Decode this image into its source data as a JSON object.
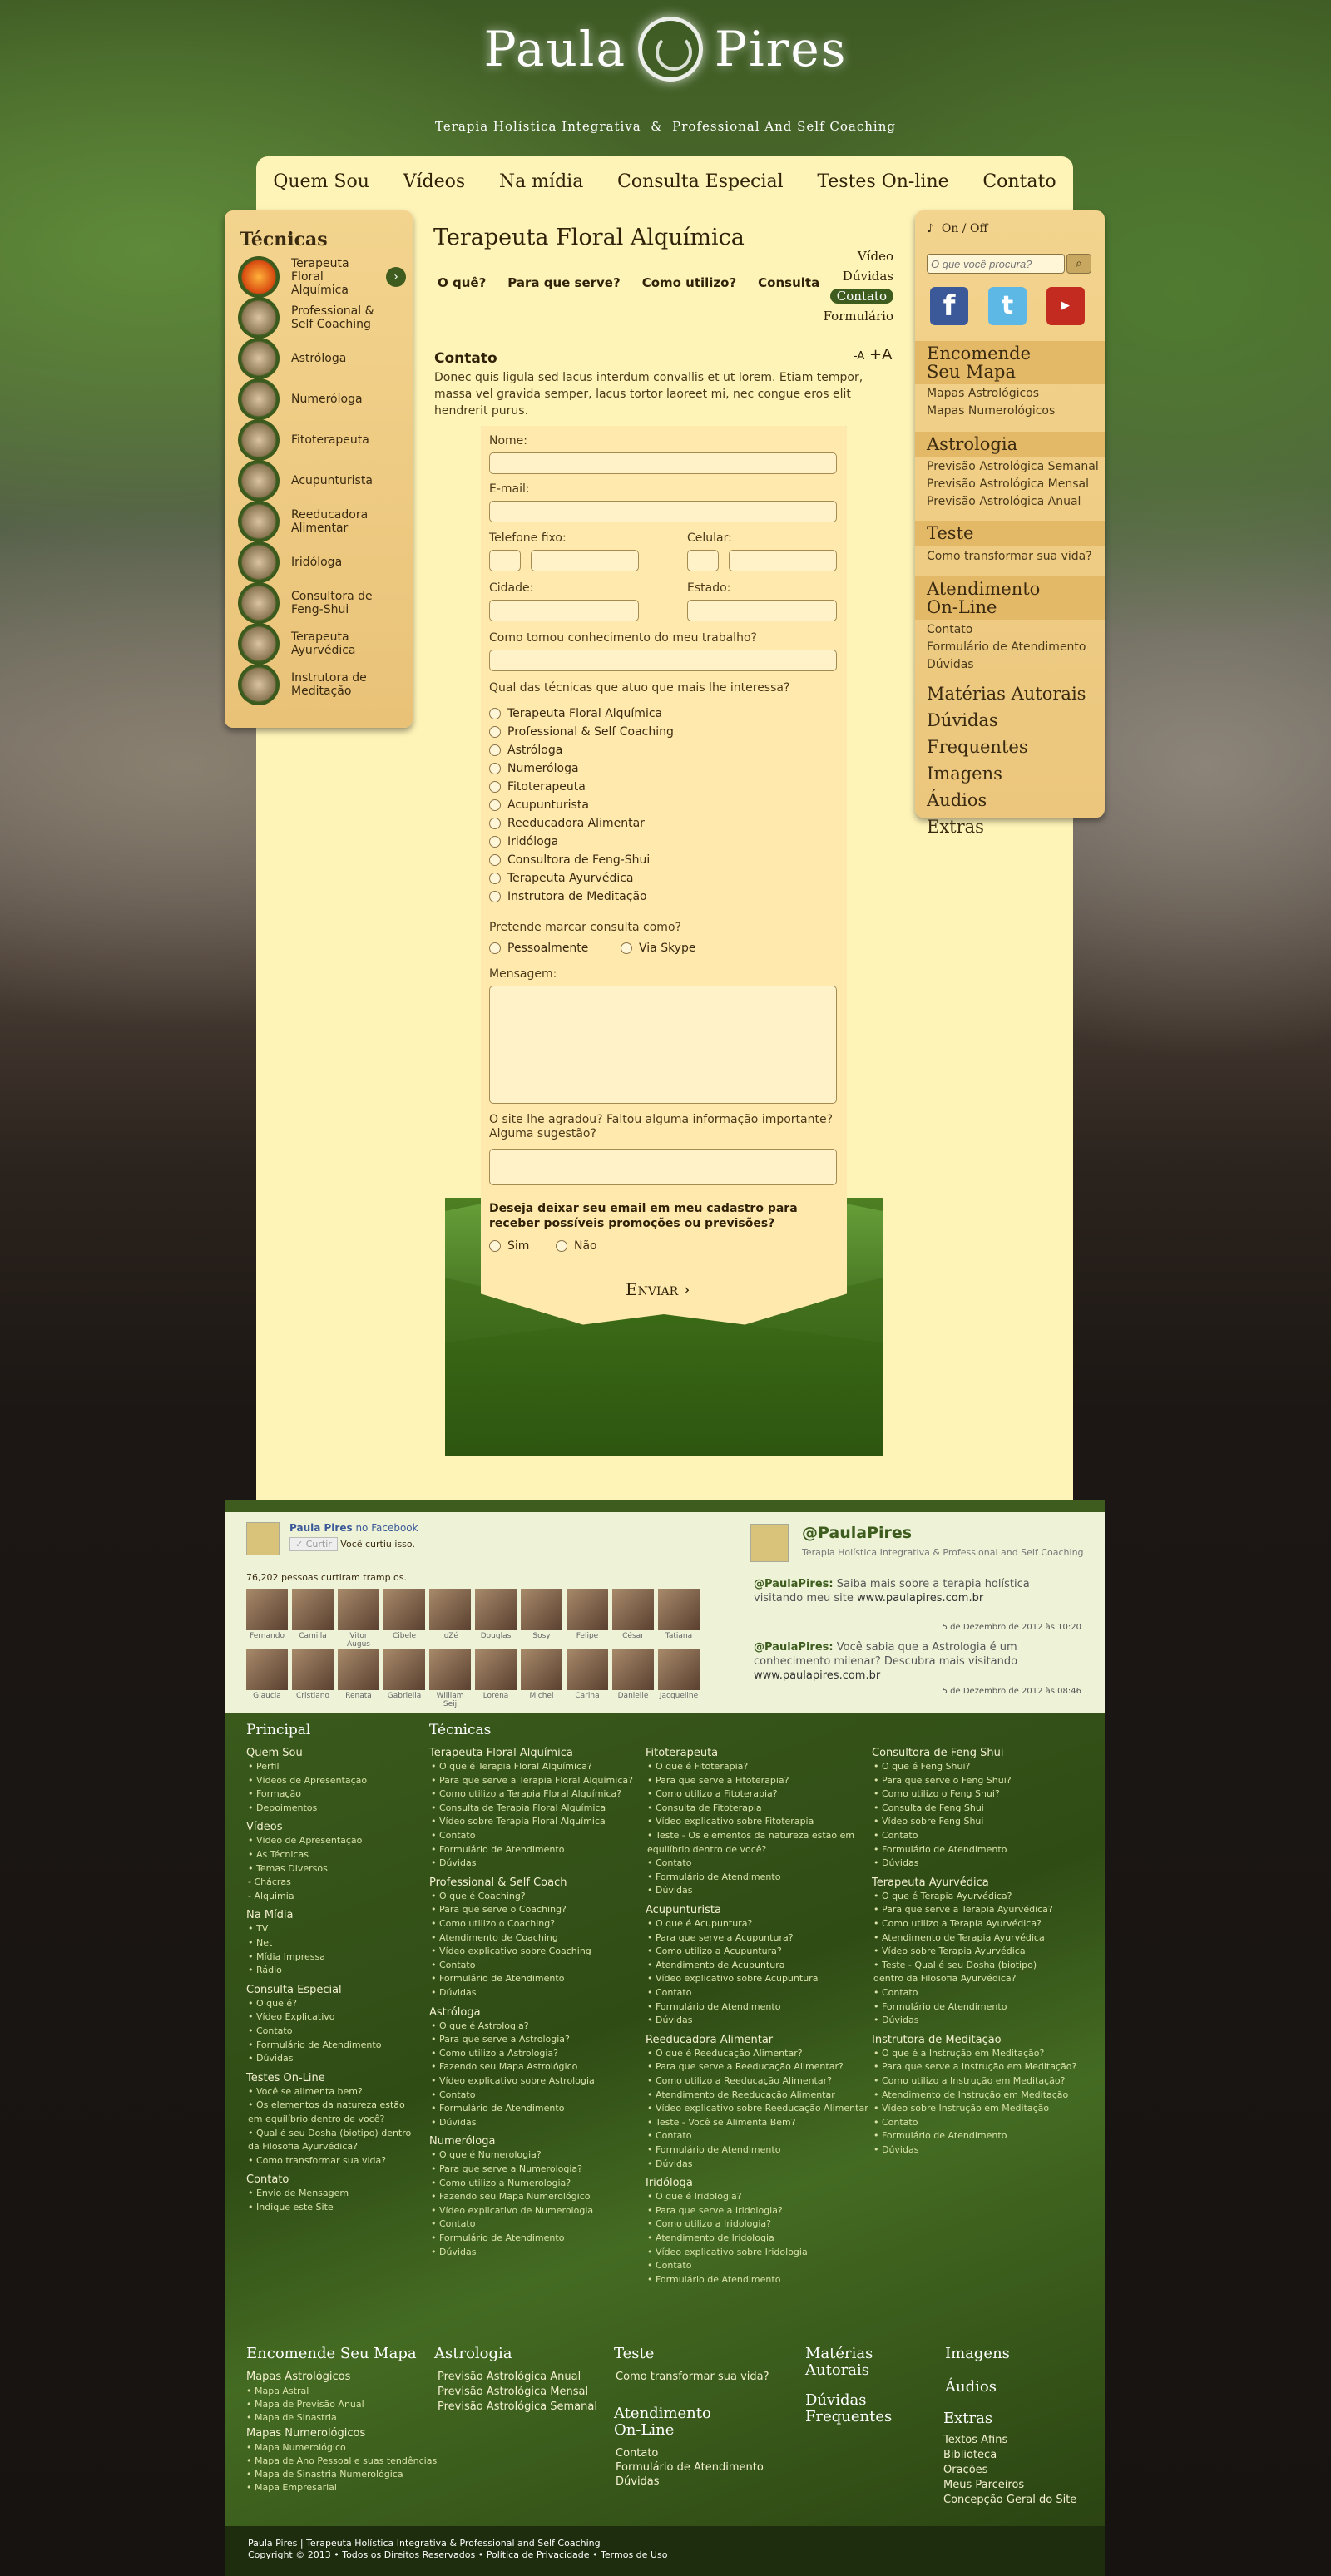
{
  "header": {
    "brand_left": "Paula",
    "brand_right": "Pires",
    "tagline_left": "Terapia Holística Integrativa",
    "tagline_amp": "&",
    "tagline_right": "Professional And Self Coaching"
  },
  "nav": [
    "Quem Sou",
    "Vídeos",
    "Na mídia",
    "Consulta Especial",
    "Testes On-line",
    "Contato"
  ],
  "left": {
    "title": "Técnicas",
    "items": [
      "Terapeuta Floral Alquímica",
      "Professional & Self Coaching",
      "Astróloga",
      "Numeróloga",
      "Fitoterapeuta",
      "Acupunturista",
      "Reeducadora Alimentar",
      "Iridóloga",
      "Consultora de Feng-Shui",
      "Terapeuta Ayurvédica",
      "Instrutora de Meditação"
    ],
    "arrow": "›"
  },
  "page": {
    "title": "Terapeuta Floral Alquímica",
    "subnav": [
      "O quê?",
      "Para que serve?",
      "Como utilizo?",
      "Consulta"
    ],
    "sidenav": [
      "Vídeo",
      "Dúvidas",
      "Contato",
      "Formulário"
    ],
    "contact_heading": "Contato",
    "font_small": "-A",
    "font_big": "+A",
    "intro": "Donec quis ligula sed lacus interdum convallis et ut lorem. Etiam tempor, massa vel gravida semper, lacus tortor laoreet mi, nec congue eros elit hendrerit purus."
  },
  "form": {
    "nome": "Nome:",
    "email": "E-mail:",
    "telefone": "Telefone fixo:",
    "celular": "Celular:",
    "cidade": "Cidade:",
    "estado": "Estado:",
    "conhecimento": "Como tomou conhecimento do meu trabalho?",
    "tecnicas_q": "Qual das técnicas que atuo que mais lhe interessa?",
    "tecnicas": [
      "Terapeuta Floral Alquímica",
      "Professional & Self Coaching",
      "Astróloga",
      "Numeróloga",
      "Fitoterapeuta",
      "Acupunturista",
      "Reeducadora Alimentar",
      "Iridóloga",
      "Consultora de Feng-Shui",
      "Terapeuta Ayurvédica",
      "Instrutora de Meditação"
    ],
    "consulta_q": "Pretende marcar consulta como?",
    "pessoal": "Pessoalmente",
    "skype": "Via Skype",
    "mensagem": "Mensagem:",
    "sugestao": "O site lhe agradou? Faltou alguma informação importante? Alguma sugestão?",
    "cadastro": "Deseja deixar seu email em meu cadastro para receber possíveis promoções ou previsões?",
    "sim": "Sim",
    "nao": "Não",
    "enviar": "Enviar"
  },
  "right": {
    "audio_on": "On",
    "audio_sep": "/",
    "audio_off": "Off",
    "search_placeholder": "O que você procura?",
    "s1": "Encomende Seu Mapa",
    "s1_links": [
      "Mapas Astrológicos",
      "Mapas Numerológicos"
    ],
    "s2": "Astrologia",
    "s2_links": [
      "Previsão Astrológica Semanal",
      "Previsão Astrológica Mensal",
      "Previsão Astrológica Anual"
    ],
    "s3": "Teste",
    "s3_links": [
      "Como transformar sua vida?"
    ],
    "s4": "Atendimento On-Line",
    "s4_links": [
      "Contato",
      "Formulário de Atendimento",
      "Dúvidas"
    ],
    "s5": [
      "Matérias Autorais",
      "Dúvidas Frequentes",
      "Imagens",
      "Áudios",
      "Extras"
    ]
  },
  "facebook": {
    "page": "Paula Pires",
    "on": "no Facebook",
    "curtir": "Curtir",
    "curtiu": "Você curtiu isso.",
    "count": "76,202 pessoas curtiram tramp os.",
    "faces": [
      "Fernando",
      "Camilla",
      "Vitor Augus",
      "Cibele",
      "JoZé",
      "Douglas",
      "Sosy",
      "Felipe",
      "César",
      "Tatiana",
      "Glaucia",
      "Cristiano",
      "Renata",
      "Gabriella",
      "William Seij",
      "Lorena",
      "Michel",
      "Carina",
      "Danielle",
      "Jacqueline"
    ]
  },
  "twitter": {
    "handle": "@PaulaPires",
    "desc": "Terapia Holística Integrativa & Professional and Self Coaching",
    "t1_user": "@PaulaPires:",
    "t1": "Saiba mais sobre a terapia holística visitando meu site",
    "t1_link": "www.paulapires.com.br",
    "t1_date": "5 de Dezembro de 2012 às 10:20",
    "t2_user": "@PaulaPires:",
    "t2": "Você sabia que a Astrologia é um conhecimento milenar? Descubra mais visitando",
    "t2_link": "www.paulapires.com.br",
    "t2_date": "5 de Dezembro de 2012 às 08:46"
  },
  "footer": {
    "principal": "Principal",
    "tecnicas": "Técnicas",
    "col1": [
      [
        "Quem Sou",
        [
          "• Perfil",
          "• Vídeos de Apresentação",
          "• Formação",
          "• Depoimentos"
        ]
      ],
      [
        "Vídeos",
        [
          "• Vídeo de Apresentação",
          "• As Técnicas",
          "• Temas Diversos",
          "   - Chácras",
          "   - Alquimia"
        ]
      ],
      [
        "Na Mídia",
        [
          "• TV",
          "• Net",
          "• Mídia Impressa",
          "• Rádio"
        ]
      ],
      [
        "Consulta Especial",
        [
          "• O que é?",
          "• Vídeo Explicativo",
          "• Contato",
          "• Formulário de Atendimento",
          "• Dúvidas"
        ]
      ],
      [
        "Testes On-Line",
        [
          "• Você se alimenta bem?",
          "• Os elementos da natureza estão",
          "  em equilíbrio dentro de você?",
          "• Qual é seu Dosha (biotipo) dentro",
          "  da Filosofia Ayurvédica?",
          "• Como transformar sua vida?"
        ]
      ],
      [
        "Contato",
        [
          "• Envio de Mensagem",
          "• Indique este Site"
        ]
      ]
    ],
    "col2": [
      [
        "Terapeuta Floral Alquímica",
        [
          "• O que é Terapia Floral Alquímica?",
          "• Para que serve a Terapia Floral Alquímica?",
          "• Como utilizo a Terapia Floral Alquímica?",
          "• Consulta de Terapia Floral Alquímica",
          "• Vídeo sobre Terapia Floral Alquímica",
          "• Contato",
          "• Formulário de Atendimento",
          "• Dúvidas"
        ]
      ],
      [
        "Professional & Self Coach",
        [
          "• O que é Coaching?",
          "• Para que serve o Coaching?",
          "• Como utilizo o Coaching?",
          "• Atendimento de Coaching",
          "• Vídeo explicativo sobre Coaching",
          "• Contato",
          "• Formulário de Atendimento",
          "• Dúvidas"
        ]
      ],
      [
        "Astróloga",
        [
          "• O que é Astrologia?",
          "• Para que serve a Astrologia?",
          "• Como utilizo a Astrologia?",
          "• Fazendo seu Mapa Astrológico",
          "• Vídeo explicativo sobre Astrologia",
          "• Contato",
          "• Formulário de Atendimento",
          "• Dúvidas"
        ]
      ],
      [
        "Numeróloga",
        [
          "• O que é Numerologia?",
          "• Para que serve a Numerologia?",
          "• Como utilizo a Numerologia?",
          "• Fazendo seu Mapa Numerológico",
          "• Vídeo explicativo de Numerologia",
          "• Contato",
          "• Formulário de Atendimento",
          "• Dúvidas"
        ]
      ]
    ],
    "col3": [
      [
        "Fitoterapeuta",
        [
          "• O que é Fitoterapia?",
          "• Para que serve a Fitoterapia?",
          "• Como utilizo a Fitoterapia?",
          "• Consulta de Fitoterapia",
          "• Vídeo explicativo sobre Fitoterapia",
          "• Teste - Os elementos da natureza estão em",
          "  equilíbrio dentro de você?",
          "• Contato",
          "• Formulário de Atendimento",
          "• Dúvidas"
        ]
      ],
      [
        "Acupunturista",
        [
          "• O que é Acupuntura?",
          "• Para que serve a Acupuntura?",
          "• Como utilizo a Acupuntura?",
          "• Atendimento de Acupuntura",
          "• Vídeo explicativo sobre Acupuntura",
          "• Contato",
          "• Formulário de Atendimento",
          "• Dúvidas"
        ]
      ],
      [
        "Reeducadora Alimentar",
        [
          "• O que é Reeducação Alimentar?",
          "• Para que serve a Reeducação Alimentar?",
          "• Como utilizo a Reeducação Alimentar?",
          "• Atendimento de Reeducação Alimentar",
          "• Vídeo explicativo sobre Reeducação Alimentar",
          "• Teste - Você se Alimenta Bem?",
          "• Contato",
          "• Formulário de Atendimento",
          "• Dúvidas"
        ]
      ],
      [
        "Iridóloga",
        [
          "• O que é Iridologia?",
          "• Para que serve a Iridologia?",
          "• Como utilizo a Iridologia?",
          "• Atendimento de Iridologia",
          "• Vídeo explicativo sobre Iridologia",
          "• Contato",
          "• Formulário de Atendimento"
        ]
      ]
    ],
    "col4": [
      [
        "Consultora de Feng Shui",
        [
          "• O que é Feng Shui?",
          "• Para que serve o Feng Shui?",
          "• Como utilizo o Feng Shui?",
          "• Consulta de Feng Shui",
          "• Vídeo sobre Feng Shui",
          "• Contato",
          "• Formulário de Atendimento",
          "• Dúvidas"
        ]
      ],
      [
        "Terapeuta Ayurvédica",
        [
          "• O que é Terapia Ayurvédica?",
          "• Para que serve a Terapia Ayurvédica?",
          "• Como utilizo a Terapia Ayurvédica?",
          "• Atendimento de Terapia Ayurvédica",
          "• Vídeo sobre Terapia Ayurvédica",
          "• Teste - Qual é seu Dosha (biotipo)",
          "  dentro da Filosofia Ayurvédica?",
          "• Contato",
          "• Formulário de Atendimento",
          "• Dúvidas"
        ]
      ],
      [
        "Instrutora de Meditação",
        [
          "• O que é a Instrução em Meditação?",
          "• Para que serve a Instrução em Meditação?",
          "• Como utilizo a Instrução em Meditação?",
          "• Atendimento de Instrução em Meditação",
          "• Vídeo sobre Instrução em Meditação",
          "• Contato",
          "• Formulário de Atendimento",
          "• Dúvidas"
        ]
      ]
    ],
    "b_mapa": "Encomende Seu Mapa",
    "b_mapa_l1": "Mapas Astrológicos",
    "b_mapa_l1s": [
      "• Mapa Astral",
      "• Mapa de Previsão Anual",
      "• Mapa de Sinastria"
    ],
    "b_mapa_l2": "Mapas Numerológicos",
    "b_mapa_l2s": [
      "• Mapa Numerológico",
      "• Mapa de Ano Pessoal e suas tendências",
      "• Mapa de Sinastria Numerológica",
      "• Mapa Empresarial"
    ],
    "b_astro": "Astrologia",
    "b_astro_l": [
      "Previsão Astrológica Anual",
      "Previsão Astrológica Mensal",
      "Previsão Astrológica Semanal"
    ],
    "b_teste": "Teste",
    "b_teste_l": "Como transformar sua vida?",
    "b_atend": "Atendimento On-Line",
    "b_atend_l": [
      "Contato",
      "Formulário de Atendimento",
      "Dúvidas"
    ],
    "b_mat": "Matérias Autorais",
    "b_duv": "Dúvidas Frequentes",
    "b_img": "Imagens",
    "b_aud": "Áudios",
    "b_ext": "Extras",
    "b_ext_l": [
      "Textos Afins",
      "Biblioteca",
      "Orações",
      "Meus Parceiros",
      "Concepção Geral do Site"
    ]
  },
  "copyright": {
    "l1": "Paula Pires | Terapeuta Holística Integrativa & Professional and Self Coaching",
    "l2": "Copyright © 2013 • Todos os Direitos Reservados •",
    "priv": "Política de Privacidade",
    "sep": "•",
    "terms": "Termos de Uso"
  },
  "colors": {
    "accent": "#3d5c1e",
    "panel": "#fff4b8",
    "sidebar": "#f0cf88"
  }
}
